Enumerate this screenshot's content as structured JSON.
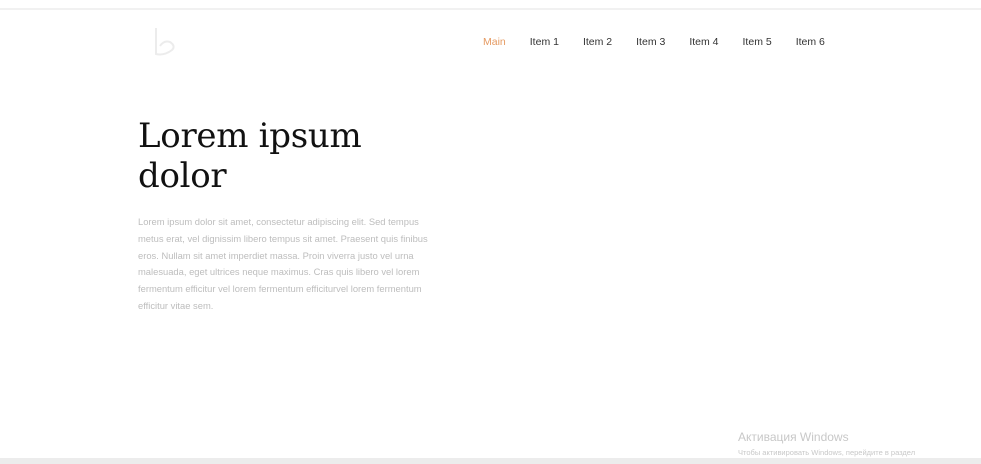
{
  "nav": {
    "items": [
      {
        "label": "Main",
        "active": true
      },
      {
        "label": "Item 1",
        "active": false
      },
      {
        "label": "Item 2",
        "active": false
      },
      {
        "label": "Item 3",
        "active": false
      },
      {
        "label": "Item 4",
        "active": false
      },
      {
        "label": "Item 5",
        "active": false
      },
      {
        "label": "Item 6",
        "active": false
      }
    ],
    "active_color": "#e59a62"
  },
  "hero": {
    "title": "Lorem ipsum dolor",
    "text": "Lorem ipsum dolor sit amet, consectetur adipiscing elit. Sed tempus metus erat, vel dignissim libero tempus sit amet. Praesent quis finibus eros. Nullam sit amet imperdiet massa. Proin viverra justo vel urna malesuada, eget ultrices neque maximus. Cras quis libero vel lorem fermentum efficitur vel lorem fermentum efficiturvel lorem fermentum efficitur vitae sem."
  },
  "windows_activation": {
    "title": "Активация Windows",
    "subtitle": "Чтобы активировать Windows, перейдите в раздел"
  },
  "icons": {
    "logo": "logo-icon"
  }
}
